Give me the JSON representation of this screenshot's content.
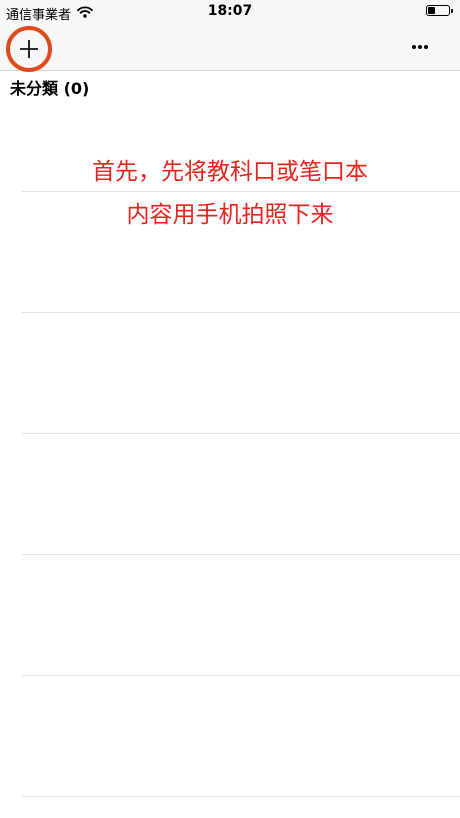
{
  "status_bar": {
    "carrier": "通信事業者",
    "time": "18:07",
    "battery_level": 0.35
  },
  "nav": {
    "add_icon": "plus-icon",
    "more_icon": "ellipsis-icon"
  },
  "section": {
    "title": "未分類 (0)"
  },
  "annotation": {
    "line1": "首先，先将教科口或笔口本",
    "line2": "内容用手机拍照下来"
  },
  "list": {
    "row_count": 6
  },
  "colors": {
    "annotation": "#e8231c",
    "circle_highlight": "#e04a1c"
  }
}
